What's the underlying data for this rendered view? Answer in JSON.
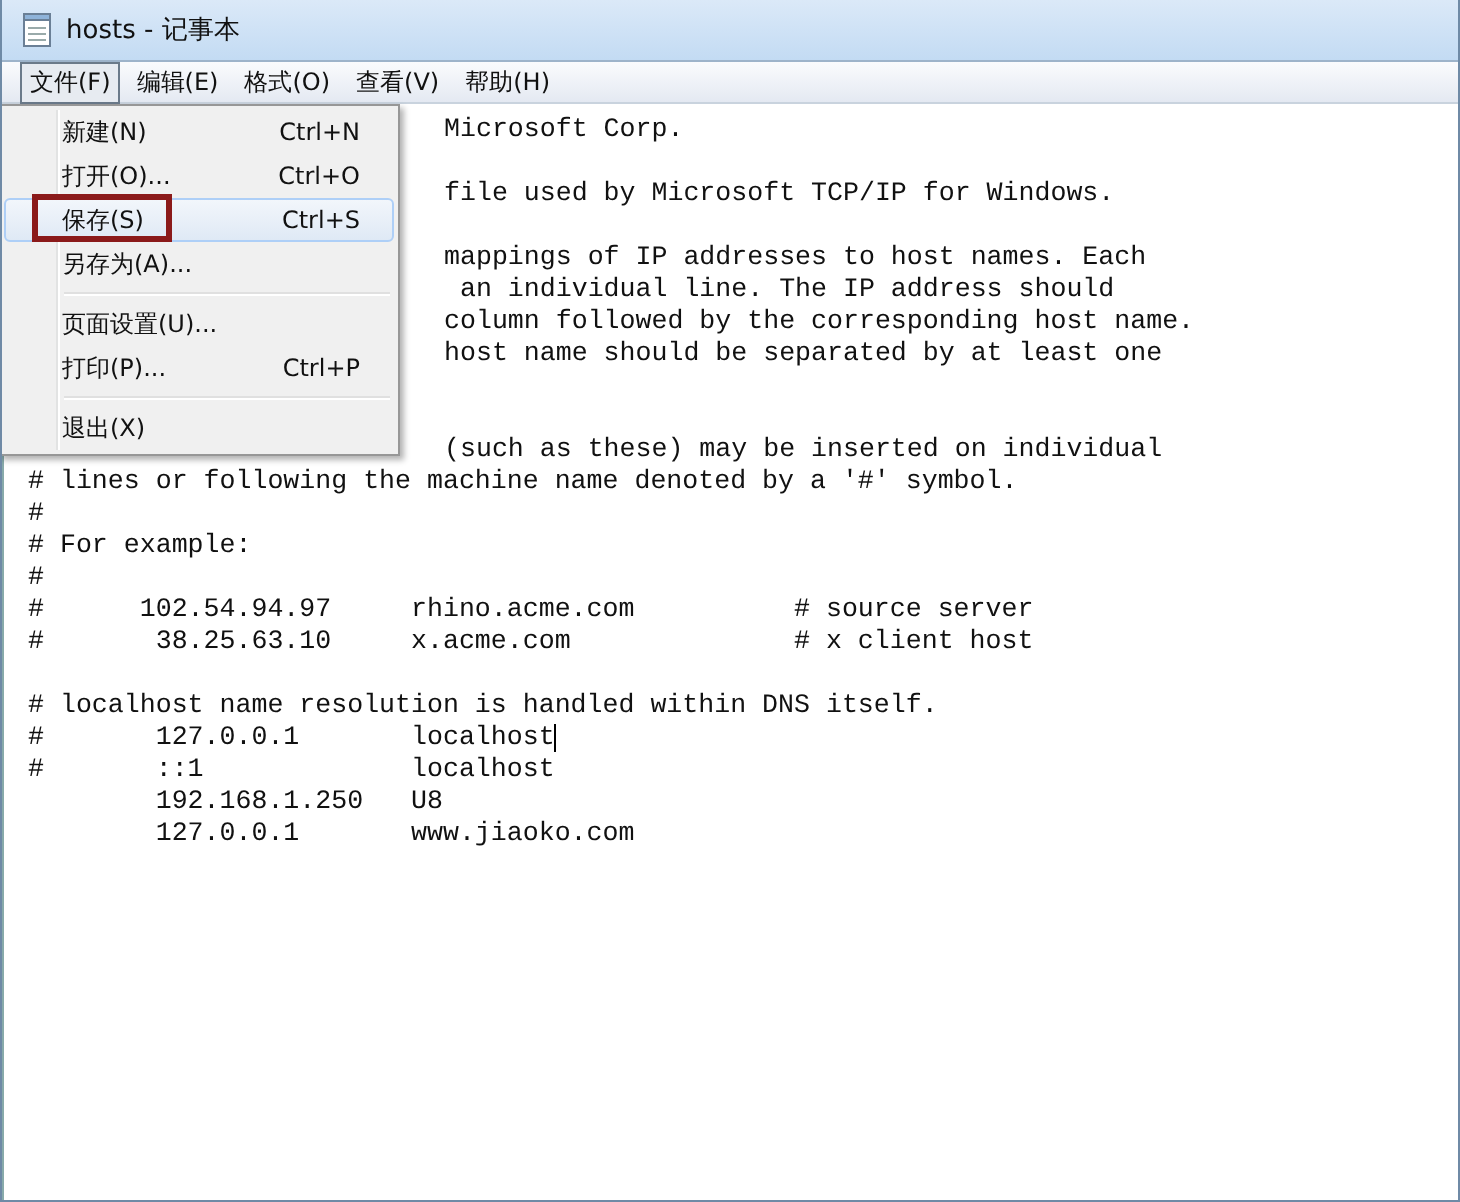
{
  "window": {
    "title": "hosts - 记事本"
  },
  "menubar": [
    {
      "label": "文件(F)",
      "selected": true
    },
    {
      "label": "编辑(E)",
      "selected": false
    },
    {
      "label": "格式(O)",
      "selected": false
    },
    {
      "label": "查看(V)",
      "selected": false
    },
    {
      "label": "帮助(H)",
      "selected": false
    }
  ],
  "file_menu": [
    {
      "kind": "item",
      "label": "新建(N)",
      "shortcut": "Ctrl+N",
      "selected": false,
      "annotated": false
    },
    {
      "kind": "item",
      "label": "打开(O)...",
      "shortcut": "Ctrl+O",
      "selected": false,
      "annotated": false
    },
    {
      "kind": "item",
      "label": "保存(S)",
      "shortcut": "Ctrl+S",
      "selected": true,
      "annotated": true
    },
    {
      "kind": "item",
      "label": "另存为(A)...",
      "selected": false,
      "annotated": false
    },
    {
      "kind": "separator"
    },
    {
      "kind": "item",
      "label": "页面设置(U)...",
      "selected": false,
      "annotated": false
    },
    {
      "kind": "item",
      "label": "打印(P)...",
      "shortcut": "Ctrl+P",
      "selected": false,
      "annotated": false
    },
    {
      "kind": "separator"
    },
    {
      "kind": "item",
      "label": "退出(X)",
      "selected": false,
      "annotated": false
    }
  ],
  "editor": {
    "lines": [
      {
        "kind": "partial",
        "text": "Microsoft Corp.",
        "caret": false
      },
      {
        "kind": "blank",
        "caret": false
      },
      {
        "kind": "partial",
        "text": "file used by Microsoft TCP/IP for Windows.",
        "caret": false
      },
      {
        "kind": "blank",
        "caret": false
      },
      {
        "kind": "partial",
        "text": "mappings of IP addresses to host names. Each",
        "caret": false
      },
      {
        "kind": "partial",
        "text": " an individual line. The IP address should",
        "caret": false
      },
      {
        "kind": "partial",
        "text": "column followed by the corresponding host name.",
        "caret": false
      },
      {
        "kind": "partial",
        "text": "host name should be separated by at least one",
        "caret": false
      },
      {
        "kind": "blank",
        "caret": false
      },
      {
        "kind": "blank",
        "caret": false
      },
      {
        "kind": "partial",
        "text": "(such as these) may be inserted on individual",
        "caret": false
      },
      {
        "kind": "full",
        "text": "# lines or following the machine name denoted by a '#' symbol.",
        "caret": false
      },
      {
        "kind": "full",
        "text": "#",
        "caret": false
      },
      {
        "kind": "full",
        "text": "# For example:",
        "caret": false
      },
      {
        "kind": "full",
        "text": "#",
        "caret": false
      },
      {
        "kind": "full",
        "text": "#      102.54.94.97     rhino.acme.com          # source server",
        "caret": false
      },
      {
        "kind": "full",
        "text": "#       38.25.63.10     x.acme.com              # x client host",
        "caret": false
      },
      {
        "kind": "blank",
        "caret": false
      },
      {
        "kind": "full",
        "text": "# localhost name resolution is handled within DNS itself.",
        "caret": false
      },
      {
        "kind": "full",
        "text": "#       127.0.0.1       localhost",
        "caret": true
      },
      {
        "kind": "full",
        "text": "#       ::1             localhost",
        "caret": false
      },
      {
        "kind": "full",
        "text": "        192.168.1.250   U8",
        "caret": false
      },
      {
        "kind": "full",
        "text": "        127.0.0.1       www.jiaoko.com",
        "caret": false
      }
    ]
  }
}
